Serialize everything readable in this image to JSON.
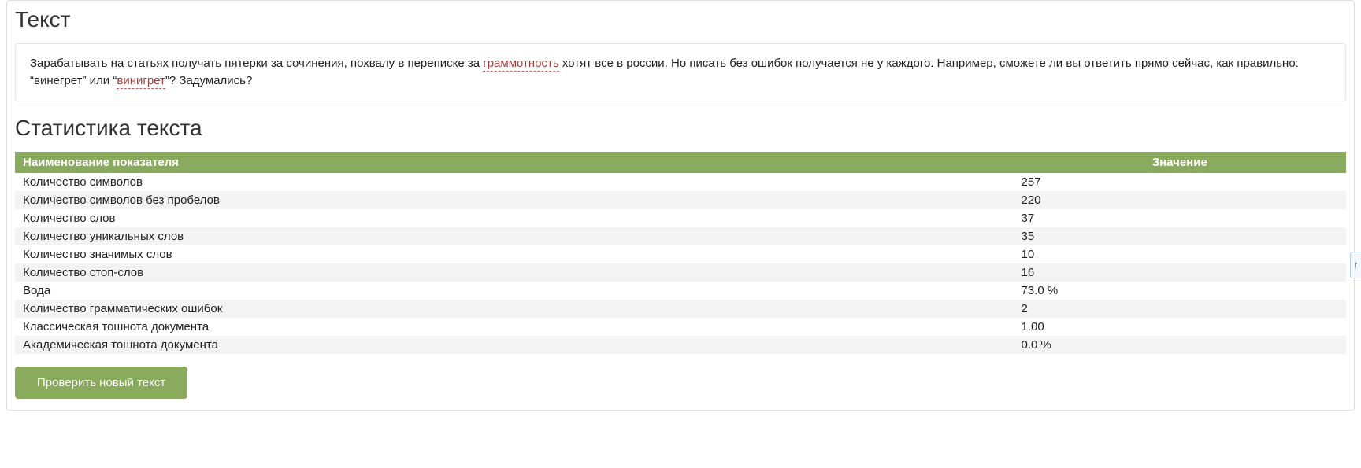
{
  "headings": {
    "text_section": "Текст",
    "stats_section": "Статистика текста"
  },
  "text_content": {
    "part1": "Зарабатывать на статьях получать пятерки за сочинения, похвалу в переписке за ",
    "error1": "граммотность",
    "part2": " хотят все в россии. Но писать без ошибок получается не у каждого. Например, сможете ли вы ответить прямо сейчас, как правильно: “винегрет” или “",
    "error2": "винигрет",
    "part3": "”? Задумались?"
  },
  "table": {
    "header_name": "Наименование показателя",
    "header_value": "Значение",
    "rows": [
      {
        "label": "Количество символов",
        "value": "257"
      },
      {
        "label": "Количество символов без пробелов",
        "value": "220"
      },
      {
        "label": "Количество слов",
        "value": "37"
      },
      {
        "label": "Количество уникальных слов",
        "value": "35"
      },
      {
        "label": "Количество значимых слов",
        "value": "10"
      },
      {
        "label": "Количество стоп-слов",
        "value": "16"
      },
      {
        "label": "Вода",
        "value": "73.0 %"
      },
      {
        "label": "Количество грамматических ошибок",
        "value": "2"
      },
      {
        "label": "Классическая тошнота документа",
        "value": "1.00"
      },
      {
        "label": "Академическая тошнота документа",
        "value": "0.0 %"
      }
    ]
  },
  "buttons": {
    "check_new": "Проверить новый текст"
  },
  "scroll_hint": "↑"
}
